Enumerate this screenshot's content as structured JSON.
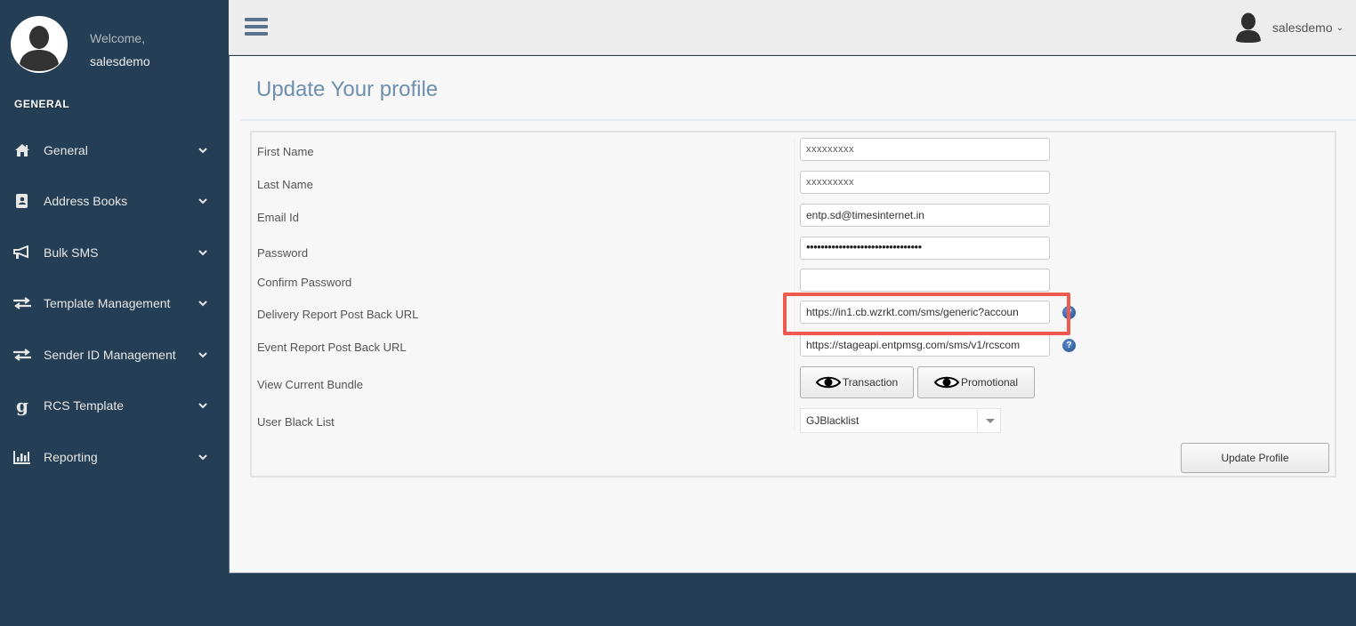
{
  "sidebar": {
    "welcome": "Welcome,",
    "username": "salesdemo",
    "section_title": "GENERAL",
    "items": [
      {
        "label": "General",
        "icon": "home-icon"
      },
      {
        "label": "Address Books",
        "icon": "address-book-icon"
      },
      {
        "label": "Bulk SMS",
        "icon": "bullhorn-icon"
      },
      {
        "label": "Template Management",
        "icon": "exchange-icon"
      },
      {
        "label": "Sender ID Management",
        "icon": "exchange-icon"
      },
      {
        "label": "RCS Template",
        "icon": "google-g-icon"
      },
      {
        "label": "Reporting",
        "icon": "bar-chart-icon"
      }
    ]
  },
  "topnav": {
    "username": "salesdemo",
    "caret": "⌄"
  },
  "page": {
    "title": "Update Your profile"
  },
  "form": {
    "first_name": {
      "label": "First Name",
      "value": "xxxxxxxxx"
    },
    "last_name": {
      "label": "Last Name",
      "value": "xxxxxxxxx"
    },
    "email": {
      "label": "Email Id",
      "value": "entp.sd@timesinternet.in"
    },
    "password": {
      "label": "Password",
      "value": "••••••••••••••••••••••••••••••••"
    },
    "confirm_password": {
      "label": "Confirm Password",
      "value": ""
    },
    "delivery_url": {
      "label": "Delivery Report Post Back URL",
      "value": "https://in1.cb.wzrkt.com/sms/generic?accoun"
    },
    "event_url": {
      "label": "Event Report Post Back URL",
      "value": "https://stageapi.entpmsg.com/sms/v1/rcscom"
    },
    "bundle": {
      "label": "View Current Bundle",
      "transaction_btn": "Transaction",
      "promotional_btn": "Promotional"
    },
    "blacklist": {
      "label": "User Black List",
      "selected": "GJBlacklist"
    },
    "help_glyph": "?",
    "submit": "Update Profile"
  },
  "colors": {
    "sidebar_bg": "#243e55",
    "title": "#6f8fae",
    "highlight": "#ef5a50"
  }
}
